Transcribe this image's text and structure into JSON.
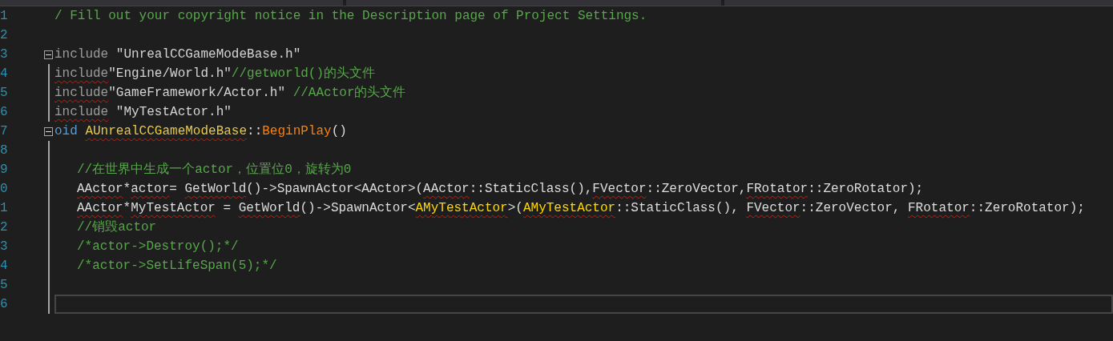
{
  "editor": {
    "lines": [
      {
        "number": "1",
        "current": false,
        "indented": false,
        "segments": [
          {
            "text": "/ Fill out your copyright notice in the Description page of Project Settings.",
            "kind": "comment",
            "underlined": false
          }
        ]
      },
      {
        "number": "2",
        "current": false
      },
      {
        "number": "3",
        "current": false,
        "indented": false,
        "fold": {
          "expanded": true
        },
        "segments": [
          {
            "text": "include",
            "kind": "preprocessor",
            "underlined": false
          },
          {
            "text": " \"UnrealCCGameModeBase.h\"",
            "kind": "string",
            "underlined": false
          }
        ]
      },
      {
        "number": "4",
        "current": false,
        "indented": false,
        "segments": [
          {
            "text": "include",
            "kind": "preprocessor",
            "underlined": true
          },
          {
            "text": "\"Engine/World.h\"",
            "kind": "string",
            "underlined": false
          },
          {
            "text": "//getworld()的头文件",
            "kind": "comment",
            "underlined": false
          }
        ]
      },
      {
        "number": "5",
        "current": false,
        "indented": false,
        "segments": [
          {
            "text": "include",
            "kind": "preprocessor",
            "underlined": true
          },
          {
            "text": "\"GameFramework/Actor.h\"",
            "kind": "string",
            "underlined": false
          },
          {
            "text": " //AActor的头文件",
            "kind": "comment",
            "underlined": false
          }
        ]
      },
      {
        "number": "6",
        "current": false,
        "indented": false,
        "segments": [
          {
            "text": "include",
            "kind": "preprocessor",
            "underlined": true
          },
          {
            "text": " \"MyTestActor.h\"",
            "kind": "string",
            "underlined": false
          }
        ]
      },
      {
        "number": "7",
        "current": false,
        "indented": false,
        "fold": {
          "expanded": true
        },
        "segments": [
          {
            "text": "oid ",
            "kind": "keyword",
            "underlined": false
          },
          {
            "text": "AUnrealCCGameModeBase",
            "kind": "type",
            "underlined": true
          },
          {
            "text": "::",
            "kind": "plain",
            "underlined": false
          },
          {
            "text": "BeginPlay",
            "kind": "function",
            "underlined": false
          },
          {
            "text": "()",
            "kind": "plain",
            "underlined": false
          }
        ]
      },
      {
        "number": "8",
        "current": false
      },
      {
        "number": "9",
        "current": false,
        "indented": true,
        "segments": [
          {
            "text": "//在世界中生成一个actor，位置位0，旋转为0",
            "kind": "comment",
            "underlined": false
          }
        ]
      },
      {
        "number": "0",
        "current": false,
        "indented": true,
        "segments": [
          {
            "text": "AActor",
            "kind": "plain",
            "underlined": true
          },
          {
            "text": "*",
            "kind": "plain",
            "underlined": false
          },
          {
            "text": "actor",
            "kind": "plain",
            "underlined": true
          },
          {
            "text": "= ",
            "kind": "plain",
            "underlined": false
          },
          {
            "text": "GetWorld",
            "kind": "plain",
            "underlined": true
          },
          {
            "text": "()->SpawnActor<AActor>(",
            "kind": "plain",
            "underlined": false
          },
          {
            "text": "AActor",
            "kind": "plain",
            "underlined": true
          },
          {
            "text": "::StaticClass(),",
            "kind": "plain",
            "underlined": false
          },
          {
            "text": "FVector",
            "kind": "plain",
            "underlined": true
          },
          {
            "text": "::ZeroVector,",
            "kind": "plain",
            "underlined": false
          },
          {
            "text": "FRotator",
            "kind": "plain",
            "underlined": true
          },
          {
            "text": "::ZeroRotator);",
            "kind": "plain",
            "underlined": false
          }
        ]
      },
      {
        "number": "1",
        "current": false,
        "indented": true,
        "segments": [
          {
            "text": "AActor",
            "kind": "plain",
            "underlined": true
          },
          {
            "text": "*",
            "kind": "plain",
            "underlined": false
          },
          {
            "text": "MyTestActor",
            "kind": "plain",
            "underlined": true
          },
          {
            "text": " = ",
            "kind": "plain",
            "underlined": false
          },
          {
            "text": "GetWorld",
            "kind": "plain",
            "underlined": true
          },
          {
            "text": "()->SpawnActor<",
            "kind": "plain",
            "underlined": false
          },
          {
            "text": "AMyTestActor",
            "kind": "class",
            "underlined": true
          },
          {
            "text": ">(",
            "kind": "plain",
            "underlined": false
          },
          {
            "text": "AMyTestActor",
            "kind": "class",
            "underlined": true
          },
          {
            "text": "::StaticClass(), ",
            "kind": "plain",
            "underlined": false
          },
          {
            "text": "FVector",
            "kind": "plain",
            "underlined": true
          },
          {
            "text": "::ZeroVector, ",
            "kind": "plain",
            "underlined": false
          },
          {
            "text": "FRotator",
            "kind": "plain",
            "underlined": true
          },
          {
            "text": "::ZeroRotator);",
            "kind": "plain",
            "underlined": false
          }
        ]
      },
      {
        "number": "2",
        "current": false,
        "indented": true,
        "segments": [
          {
            "text": "//销毁actor",
            "kind": "comment",
            "underlined": false
          }
        ]
      },
      {
        "number": "3",
        "current": false,
        "indented": true,
        "segments": [
          {
            "text": "/*actor->Destroy();*/",
            "kind": "comment",
            "underlined": false
          }
        ]
      },
      {
        "number": "4",
        "current": false,
        "indented": true,
        "segments": [
          {
            "text": "/*actor->SetLifeSpan(5);*/",
            "kind": "comment",
            "underlined": false
          }
        ]
      },
      {
        "number": "5",
        "current": false
      },
      {
        "number": "6",
        "current": true
      }
    ]
  }
}
